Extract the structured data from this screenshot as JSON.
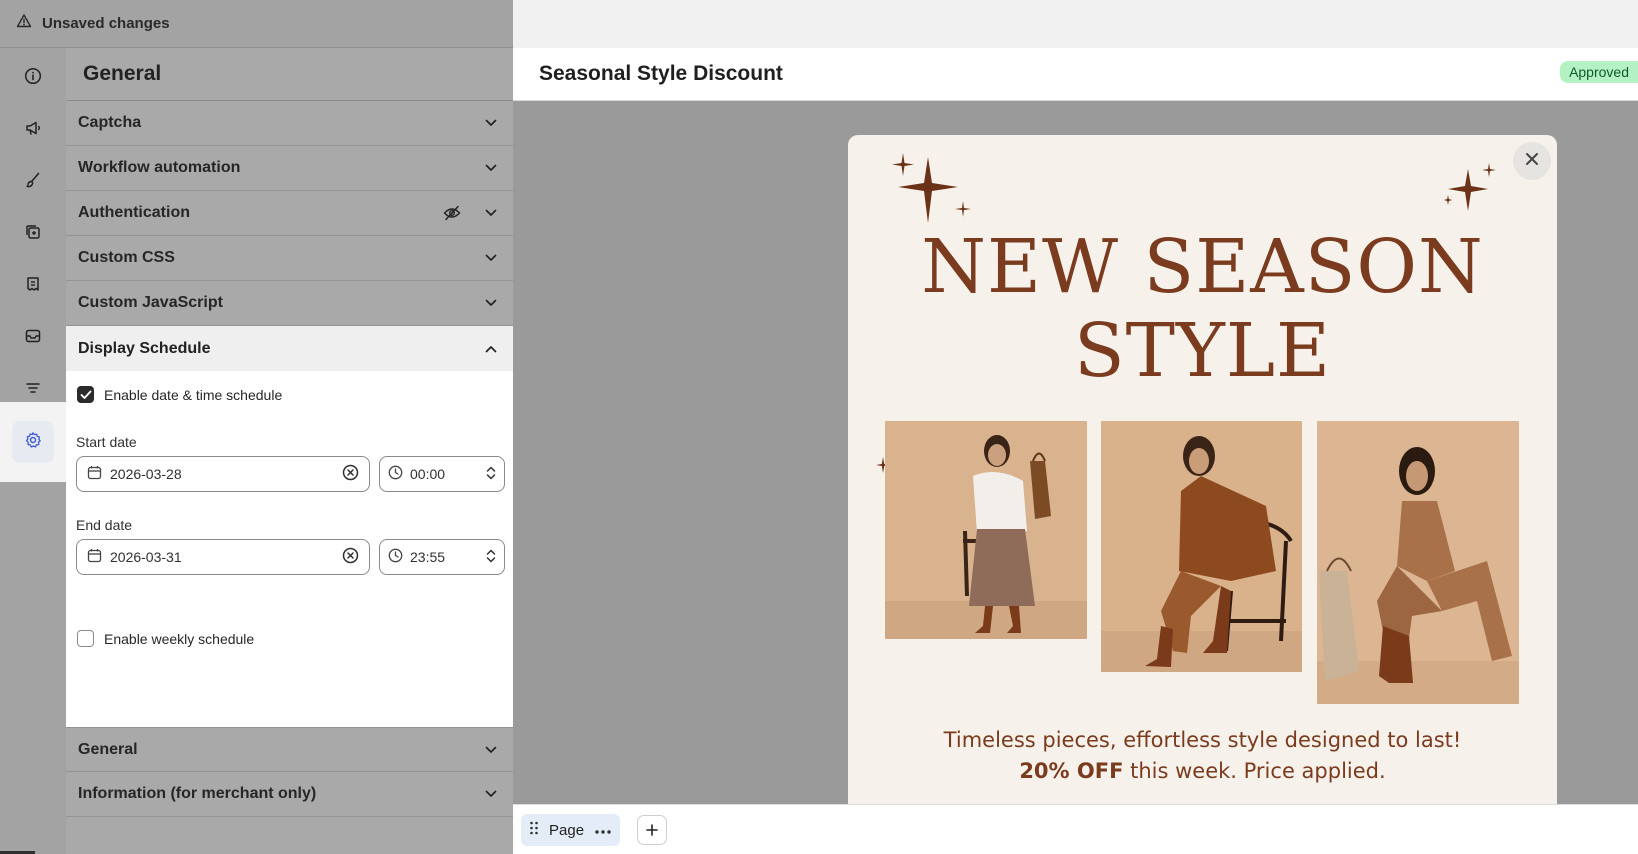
{
  "topbar": {
    "status_text": "Unsaved changes",
    "icon": "warning-icon"
  },
  "rail": {
    "items": [
      {
        "name": "info-icon"
      },
      {
        "name": "megaphone-icon"
      },
      {
        "name": "brush-icon"
      },
      {
        "name": "layers-add-icon"
      },
      {
        "name": "receipt-icon"
      },
      {
        "name": "mail-icon"
      },
      {
        "name": "filter-icon"
      },
      {
        "name": "settings-icon",
        "active": true
      }
    ]
  },
  "panel": {
    "title": "General",
    "sections": [
      {
        "label": "Captcha"
      },
      {
        "label": "Workflow automation"
      },
      {
        "label": "Authentication",
        "hidden_icon": "eye-off-icon"
      },
      {
        "label": "Custom CSS"
      },
      {
        "label": "Custom JavaScript"
      }
    ],
    "open_section": {
      "label": "Display Schedule",
      "enable_datetime": {
        "label": "Enable date & time schedule",
        "checked": true
      },
      "start": {
        "label": "Start date",
        "date": "2026-03-28",
        "time": "00:00"
      },
      "end": {
        "label": "End date",
        "date": "2026-03-31",
        "time": "23:55"
      },
      "enable_weekly": {
        "label": "Enable weekly schedule",
        "checked": false
      }
    },
    "after_sections": [
      {
        "label": "General"
      },
      {
        "label": "Information (for merchant only)"
      }
    ]
  },
  "preview": {
    "title": "Seasonal Style Discount",
    "status_badge": "Approved",
    "status_color": "#b4f2c4",
    "popup": {
      "headline_line1": "NEW SEASON",
      "headline_line2": "STYLE",
      "sub_line1": "Timeless pieces, effortless style designed to last!",
      "sub_bold": "20% OFF",
      "sub_rest": " this week. Price applied.",
      "accent_color": "#7a3b1e",
      "background_color": "#f6f1ea"
    }
  },
  "bottombar": {
    "page_label": "Page"
  }
}
